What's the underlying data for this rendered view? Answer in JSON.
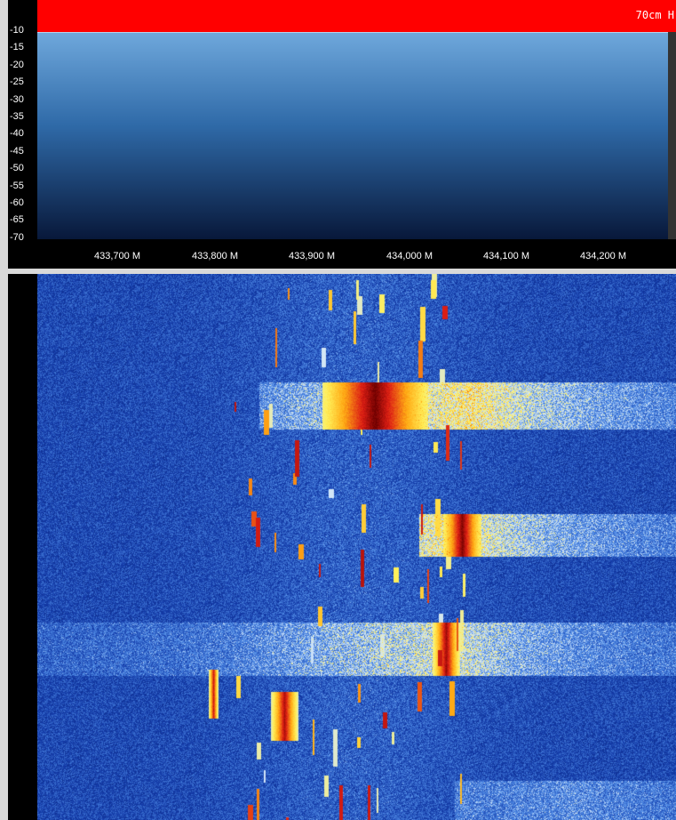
{
  "header": {
    "band_label": "70cm H"
  },
  "colors": {
    "header_bg": "#ff0000",
    "panel_bg": "#000000",
    "trace": "#ffffff",
    "fill_top": "#4f8dcc",
    "fill_bottom": "#0a1a3a"
  },
  "spectrum": {
    "db_labels": [
      "-10",
      "-15",
      "-20",
      "-25",
      "-30",
      "-35",
      "-40",
      "-45",
      "-50",
      "-55",
      "-60",
      "-65",
      "-70"
    ],
    "freq_labels": [
      "433,700 M",
      "433,800 M",
      "433,900 M",
      "434,000 M",
      "434,100 M",
      "434,200 M"
    ]
  },
  "waterfall": {
    "colormap": "blue-yellow-red"
  }
}
